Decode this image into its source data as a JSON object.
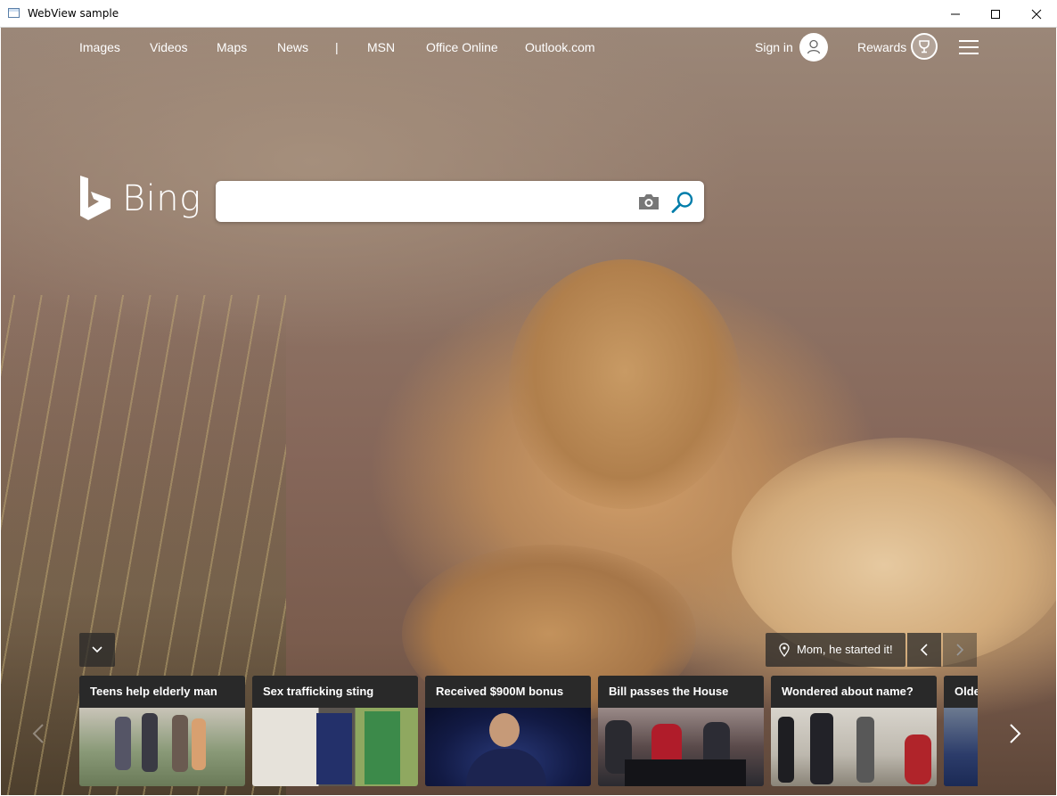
{
  "window": {
    "title": "WebView sample"
  },
  "nav": {
    "links": [
      "Images",
      "Videos",
      "Maps",
      "News",
      "MSN",
      "Office Online",
      "Outlook.com"
    ],
    "separator": "|",
    "signin_label": "Sign in",
    "rewards_label": "Rewards"
  },
  "logo": {
    "text": "Bing"
  },
  "search": {
    "value": "",
    "placeholder": ""
  },
  "image_info": {
    "label": "Mom, he started it!"
  },
  "carousel": {
    "cards": [
      {
        "title": "Teens help elderly man"
      },
      {
        "title": "Sex trafficking sting"
      },
      {
        "title": "Received $900M bonus"
      },
      {
        "title": "Bill passes the House"
      },
      {
        "title": "Wondered about name?"
      },
      {
        "title": "Olde"
      }
    ]
  },
  "colors": {
    "accent": "#007daa",
    "overlay": "#282828"
  }
}
